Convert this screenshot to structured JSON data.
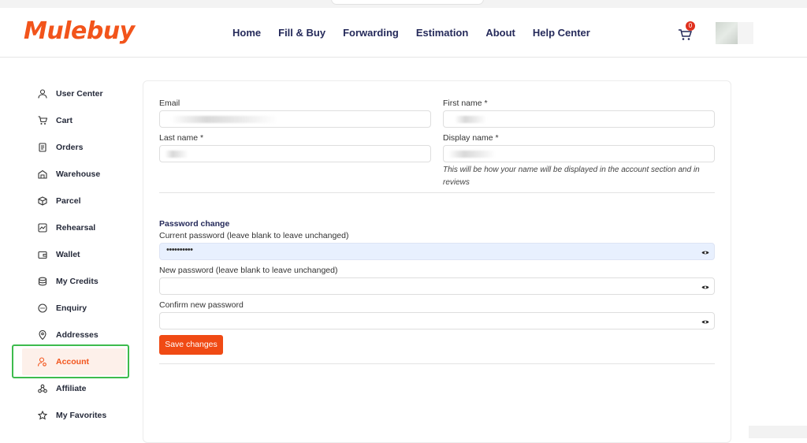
{
  "brand": {
    "logo_text": "Mulebuy",
    "accent": "#f2541b"
  },
  "nav": {
    "items": [
      "Home",
      "Fill & Buy",
      "Forwarding",
      "Estimation",
      "About",
      "Help Center"
    ]
  },
  "cart": {
    "count": "0"
  },
  "sidebar": {
    "items": [
      {
        "label": "User Center",
        "icon": "user-icon"
      },
      {
        "label": "Cart",
        "icon": "cart-icon"
      },
      {
        "label": "Orders",
        "icon": "orders-icon"
      },
      {
        "label": "Warehouse",
        "icon": "warehouse-icon"
      },
      {
        "label": "Parcel",
        "icon": "parcel-icon"
      },
      {
        "label": "Rehearsal",
        "icon": "rehearsal-icon"
      },
      {
        "label": "Wallet",
        "icon": "wallet-icon"
      },
      {
        "label": "My Credits",
        "icon": "credits-icon"
      },
      {
        "label": "Enquiry",
        "icon": "enquiry-icon"
      },
      {
        "label": "Addresses",
        "icon": "location-icon"
      },
      {
        "label": "Account",
        "icon": "account-icon",
        "active": true
      },
      {
        "label": "Affiliate",
        "icon": "affiliate-icon"
      },
      {
        "label": "My Favorites",
        "icon": "star-icon"
      }
    ]
  },
  "form": {
    "email_label": "Email",
    "first_name_label": "First name *",
    "last_name_label": "Last name *",
    "display_name_label": "Display name *",
    "display_name_hint": "This will be how your name will be displayed in the account section and in reviews",
    "password_section_title": "Password change",
    "current_password_label": "Current password (leave blank to leave unchanged)",
    "current_password_value": "••••••••••",
    "new_password_label": "New password (leave blank to leave unchanged)",
    "confirm_password_label": "Confirm new password",
    "save_label": "Save changes"
  }
}
